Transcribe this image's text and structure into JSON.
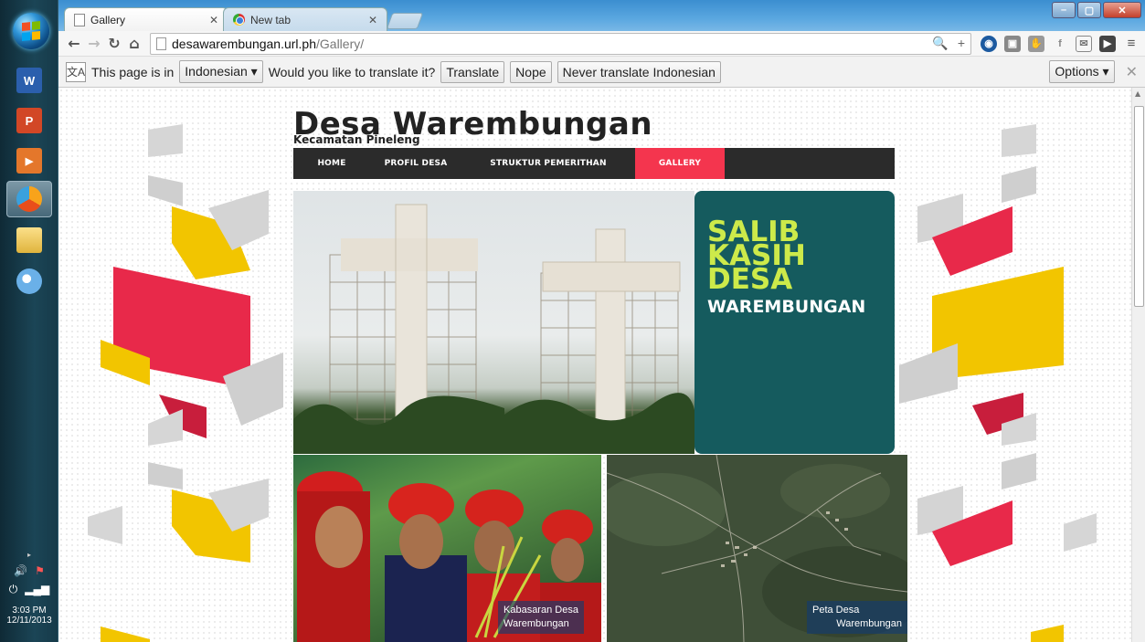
{
  "taskbar": {
    "apps": [
      {
        "name": "word",
        "label": "W"
      },
      {
        "name": "powerpoint",
        "label": "P"
      },
      {
        "name": "media",
        "label": "▶"
      },
      {
        "name": "chrome-like",
        "label": ""
      },
      {
        "name": "explorer",
        "label": ""
      },
      {
        "name": "paint",
        "label": ""
      }
    ],
    "tray": {
      "time": "3:03 PM",
      "date": "12/11/2013"
    }
  },
  "browser": {
    "tabs": [
      {
        "label": "Gallery",
        "active": true
      },
      {
        "label": "New tab",
        "active": false
      }
    ],
    "window_controls": [
      "–",
      "▢",
      "✕"
    ],
    "address": {
      "host": "desawarembungan.url.ph",
      "path": "/Gallery/"
    },
    "translate_bar": {
      "prefix": "This page is in",
      "language": "Indonesian ▾",
      "question": "Would you like to translate it?",
      "translate": "Translate",
      "nope": "Nope",
      "never": "Never translate Indonesian",
      "options": "Options ▾"
    }
  },
  "site": {
    "title": "Desa Warembungan",
    "subtitle": "Kecamatan Pineleng",
    "menu": [
      {
        "label": "HOME",
        "active": false
      },
      {
        "label": "PROFIL DESA",
        "active": false
      },
      {
        "label": "STRUKTUR PEMERITHAN",
        "active": false
      },
      {
        "label": "GALLERY",
        "active": true
      }
    ],
    "hero_card": {
      "line1": "SALIB",
      "line2": "KASIH",
      "line3": "DESA",
      "line4": "WAREMBUNGAN"
    },
    "captions": {
      "left": {
        "line1": "Kabasaran  Desa",
        "line2": "Warembungan"
      },
      "right": {
        "line1": "Peta  Desa",
        "line2": "Warembungan"
      }
    }
  },
  "colors": {
    "menu_bg": "#2b2b2b",
    "menu_active": "#f4354e",
    "card_bg": "#155b5e",
    "card_accent": "#cdea4a",
    "deco_red": "#e8294a",
    "deco_yellow": "#f2c500",
    "deco_gray": "#cfcfcf"
  }
}
